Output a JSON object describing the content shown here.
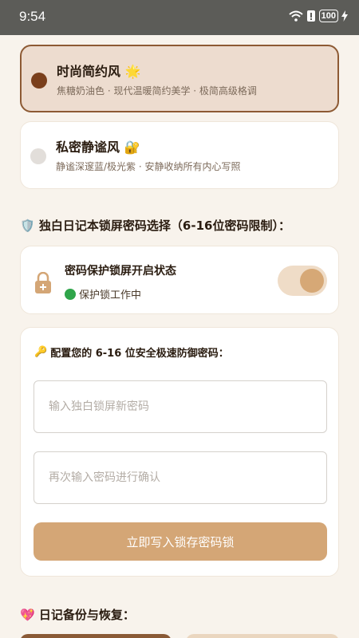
{
  "status_bar": {
    "time": "9:54",
    "battery": "100"
  },
  "themes": [
    {
      "title": "时尚简约风",
      "emoji": "🌟",
      "desc": "焦糖奶油色 · 现代温暖简约美学 · 极简高级格调",
      "selected": true
    },
    {
      "title": "私密静谧风",
      "emoji": "🔐",
      "desc": "静谧深邃蓝/极光紫 · 安静收纳所有内心写照",
      "selected": false
    }
  ],
  "lock_section": {
    "emoji": "🛡️",
    "title": "独白日记本锁屏密码选择（6-16位密码限制）：",
    "status_title": "密码保护锁屏开启状态",
    "status_text": "保护锁工作中",
    "toggle_on": true
  },
  "password": {
    "emoji": "🔑",
    "prompt": "配置您的 6-16 位安全极速防御密码：",
    "new_placeholder": "输入独白锁屏新密码",
    "confirm_placeholder": "再次输入密码进行确认",
    "save_label": "立即写入锁存密码锁"
  },
  "backup": {
    "emoji": "💖",
    "title": "日记备份与恢复："
  },
  "colors": {
    "accent": "#d4a676",
    "selected_border": "#8d5a34",
    "radio_on": "#7a3f1c"
  }
}
